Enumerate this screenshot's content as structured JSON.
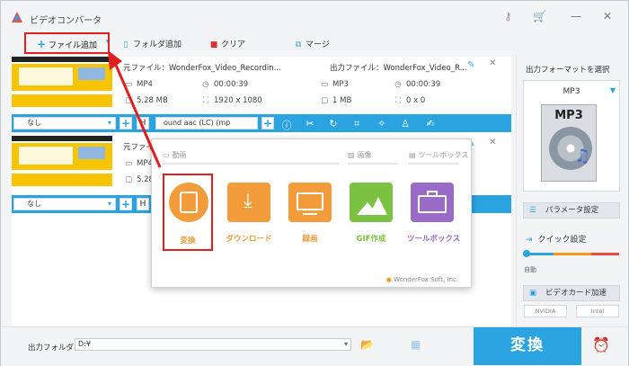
{
  "window": {
    "title": "ビデオコンバータ"
  },
  "toolbar": {
    "add_file": "ファイル追加",
    "add_folder": "フォルダ追加",
    "clear": "クリア",
    "merge": "マージ"
  },
  "items": [
    {
      "source_label": "元ファイル：WonderFox_Video_Recordin...",
      "format": "MP4",
      "duration": "00:00:39",
      "size": "5.28 MB",
      "resolution": "1920 x 1080",
      "output_label": "出力ファイル：WonderFox_Video_R...",
      "out_format": "MP3",
      "out_duration": "00:00:39",
      "out_size": "1 MB",
      "out_resolution": "0 x 0",
      "subtitle": "なし",
      "audio": "ound aac (LC) (mp"
    },
    {
      "source_label": "元ファイ",
      "format": "MP4",
      "size": "5.28",
      "subtitle": "なし"
    }
  ],
  "right_panel": {
    "title": "出力フォーマットを選択",
    "format": "MP3",
    "format_icon": "MP3",
    "params_button": "パラメータ設定",
    "quick_label": "クイック設定",
    "auto_label": "自動",
    "gpu_button": "ビデオカード加速",
    "gpu_vendors": [
      "NVIDIA",
      "Intel"
    ]
  },
  "bottom": {
    "output_folder_label": "出力フォルダ：",
    "output_folder_value": "D:¥",
    "convert_button": "変換"
  },
  "popup": {
    "sections": {
      "video": "動画",
      "image": "画像",
      "toolbox": "ツールボックス"
    },
    "tiles": [
      {
        "label": "変換",
        "color": "#f39c3c",
        "icon": "film-icon"
      },
      {
        "label": "ダウンロード",
        "color": "#f39c3c",
        "icon": "download-icon"
      },
      {
        "label": "録画",
        "color": "#f39c3c",
        "icon": "screen-record-icon"
      },
      {
        "label": "GIF作成",
        "color": "#7cc242",
        "icon": "image-icon"
      },
      {
        "label": "ツールボックス",
        "color": "#9a6cc7",
        "icon": "toolbox-icon"
      }
    ],
    "brand": "WonderFox Soft, Inc."
  }
}
